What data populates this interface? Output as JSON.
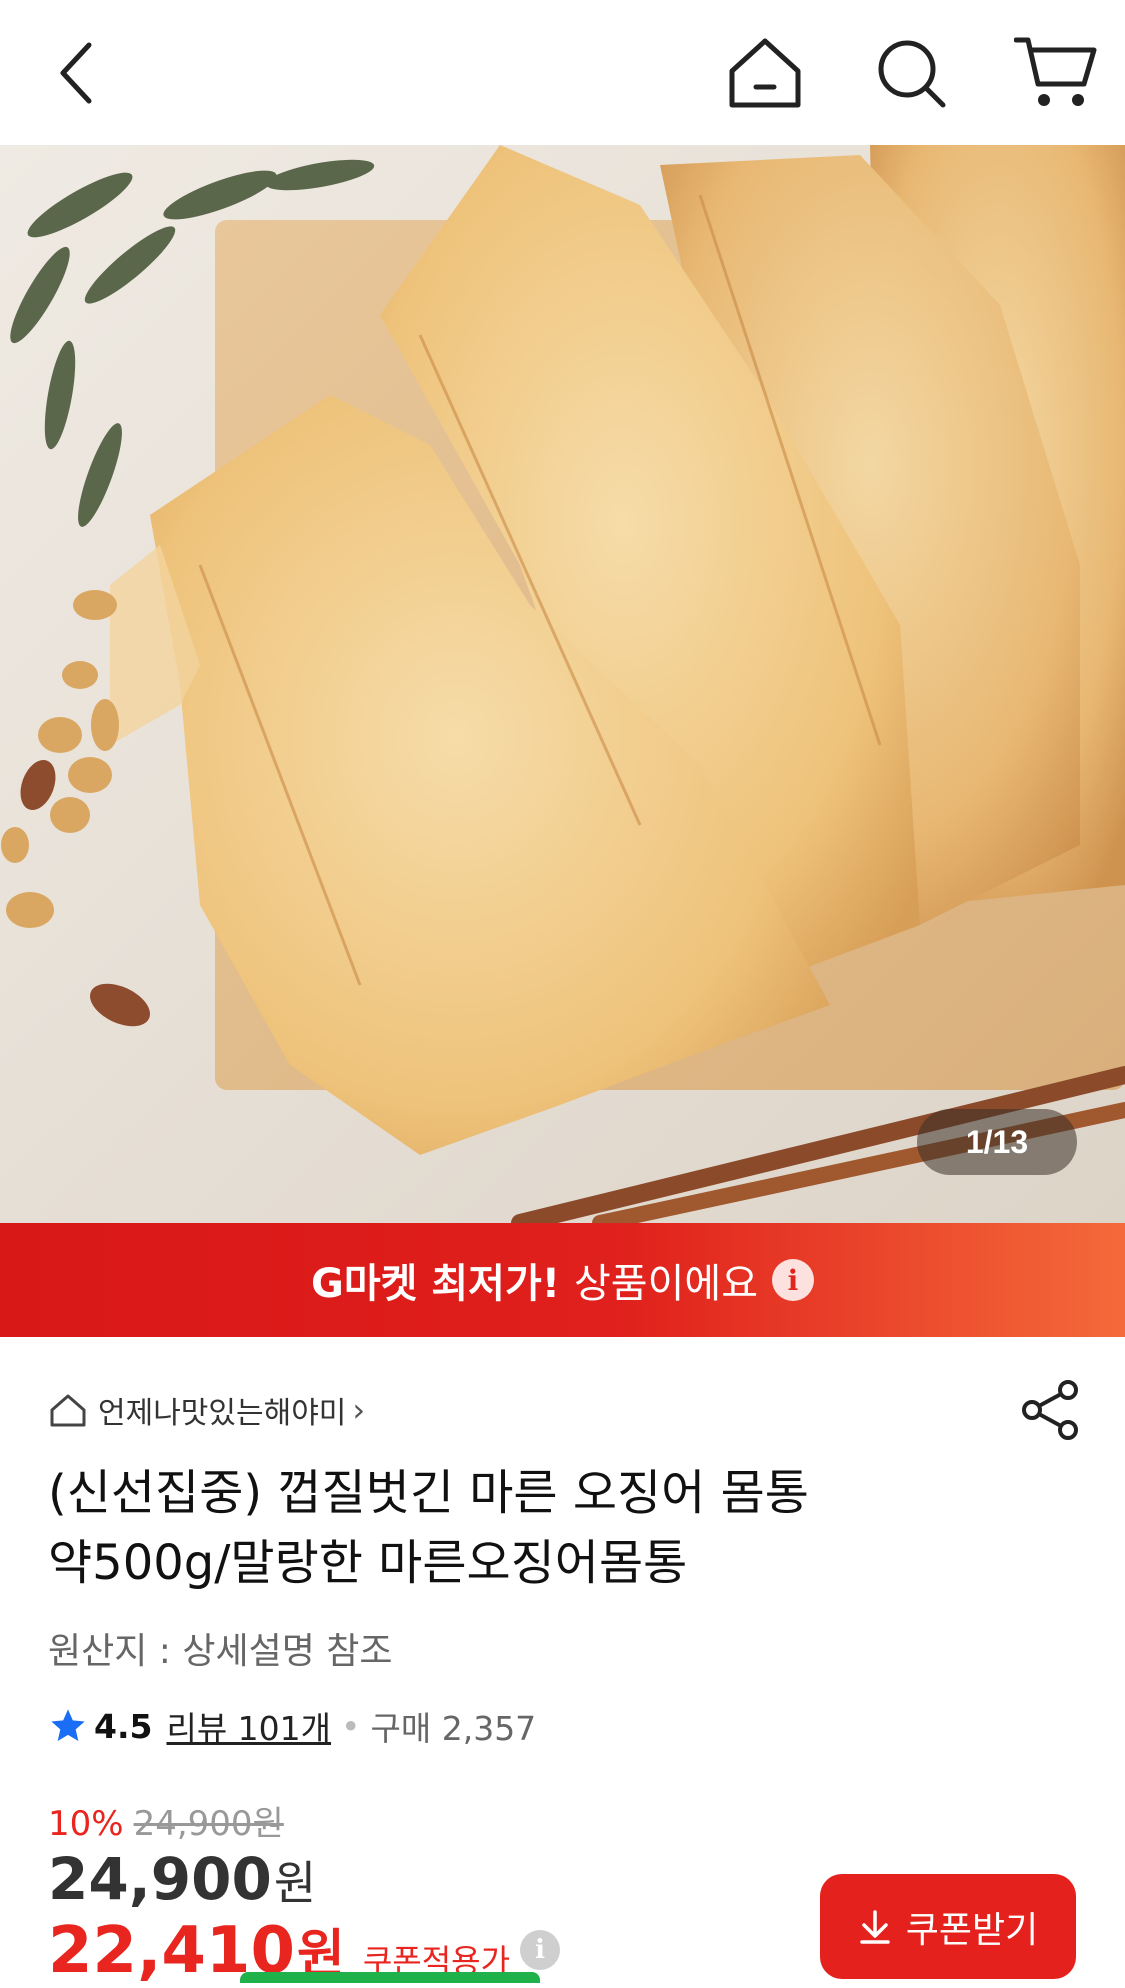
{
  "header": {
    "back_icon": "chevron-left-icon",
    "home_icon": "home-icon",
    "search_icon": "search-icon",
    "cart_icon": "cart-icon"
  },
  "hero": {
    "image_subject": "dried squid on wooden board with peanuts",
    "counter": "1/13"
  },
  "banner": {
    "bold_text": "G마켓 최저가!",
    "text": "상품이에요",
    "info_glyph": "i",
    "gradient_start": "#d81717",
    "gradient_end": "#f46a3a"
  },
  "product": {
    "seller_name": "언제나맛있는해야미",
    "title_line1": "(신선집중) 껍질벗긴 마른 오징어 몸통",
    "title_line2": "약500g/말랑한 마른오징어몸통",
    "origin": "원산지 : 상세설명 참조",
    "rating": "4.5",
    "reviews": "리뷰 101개",
    "purchases": "구매 2,357",
    "discount_pct": "10%",
    "original_price": "24,900원",
    "price": "24,900",
    "price_unit": "원",
    "coupon_price": "22,410",
    "coupon_price_unit": "원",
    "coupon_label": "쿠폰적용가",
    "coupon_button": "쿠폰받기",
    "accent_color": "#e8251f",
    "star_color": "#1a6ef5"
  }
}
